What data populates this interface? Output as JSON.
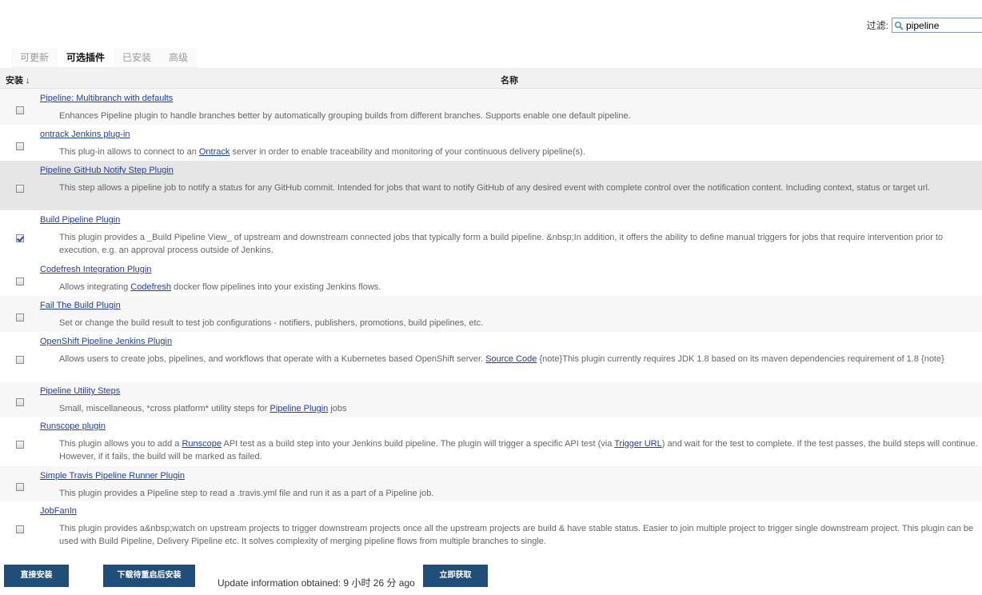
{
  "filter": {
    "label": "过滤:",
    "value": "pipeline"
  },
  "tabs": [
    {
      "label": "可更新"
    },
    {
      "label": "可选插件"
    },
    {
      "label": "已安装"
    },
    {
      "label": "高级"
    }
  ],
  "table": {
    "install_header": "安装 ↓",
    "name_header": "名称"
  },
  "plugins": [
    {
      "name": "Pipeline: Multibranch with defaults",
      "desc": [
        {
          "t": "Enhances Pipeline plugin to handle branches better by automatically grouping builds from different branches. Supports enable one default pipeline."
        }
      ],
      "checked": false
    },
    {
      "name": "ontrack Jenkins plug-in",
      "desc": [
        {
          "t": "This plug-in allows to connect to an "
        },
        {
          "t": "Ontrack",
          "link": true
        },
        {
          "t": " server in order to enable traceability and monitoring of your continuous delivery pipeline(s)."
        }
      ],
      "checked": false
    },
    {
      "name": "Pipeline GitHub Notify Step Plugin",
      "desc": [
        {
          "t": "This step allows a pipeline job to notify a status for any GitHub commit. Intended for jobs that want to notify GitHub of any desired event with complete control over the notification content. Including context, status or target url."
        }
      ],
      "checked": false
    },
    {
      "name": "Build Pipeline Plugin",
      "desc": [
        {
          "t": "This plugin provides a _Build Pipeline View_ of upstream and downstream connected jobs that typically form a build pipeline. &nbsp;In addition, it offers the ability to define manual triggers for jobs that require intervention prior to execution, e.g. an approval process outside of Jenkins."
        }
      ],
      "checked": true
    },
    {
      "name": "Codefresh Integration Plugin",
      "desc": [
        {
          "t": "Allows integrating "
        },
        {
          "t": "Codefresh",
          "link": true
        },
        {
          "t": " docker flow pipelines into your existing Jenkins flows."
        }
      ],
      "checked": false
    },
    {
      "name": "Fail The Build Plugin",
      "desc": [
        {
          "t": "Set or change the build result to test job configurations - notifiers, publishers, promotions, build pipelines, etc."
        }
      ],
      "checked": false
    },
    {
      "name": "OpenShift Pipeline Jenkins Plugin",
      "desc": [
        {
          "t": "Allows users to create jobs, pipelines, and workflows that operate with a Kubernetes based OpenShift server. "
        },
        {
          "t": "Source Code",
          "link": true
        },
        {
          "t": " {note}This plugin currently requires JDK 1.8 based on its maven dependencies requirement of 1.8 {note}"
        }
      ],
      "checked": false
    },
    {
      "name": "Pipeline Utility Steps",
      "desc": [
        {
          "t": "Small, miscellaneous, *cross platform* utility steps for "
        },
        {
          "t": "Pipeline Plugin",
          "link": true
        },
        {
          "t": " jobs"
        }
      ],
      "checked": false
    },
    {
      "name": "Runscope plugin",
      "desc": [
        {
          "t": "This plugin allows you to add a "
        },
        {
          "t": "Runscope",
          "link": true
        },
        {
          "t": " API test as a build step into your Jenkins build pipeline. The plugin will trigger a specific API test (via "
        },
        {
          "t": "Trigger URL",
          "link": true
        },
        {
          "t": ") and wait for the test to complete. If the test passes, the build steps will continue. However, if it fails, the build will be marked as failed."
        }
      ],
      "checked": false
    },
    {
      "name": "Simple Travis Pipeline Runner Plugin",
      "desc": [
        {
          "t": "This plugin provides a Pipeline step to read a .travis.yml file and run it as a part of a Pipeline job."
        }
      ],
      "checked": false
    },
    {
      "name": "JobFanIn",
      "desc": [
        {
          "t": "This plugin provides a&nbsp;watch on upstream projects to trigger downstream projects once all the upstream projects are build & have stable status. Easier to join multiple project to trigger single downstream project. This plugin can be used with Build Pipeline, Delivery Pipeline etc. It solves complexity of merging pipeline flows from multiple branches to single."
        }
      ],
      "checked": false
    }
  ],
  "footer": {
    "install_now": "直接安装",
    "download_restart": "下载待重启后安装",
    "update_info": "Update information obtained: 9 小时 26 分 ago",
    "check_now": "立即获取"
  }
}
